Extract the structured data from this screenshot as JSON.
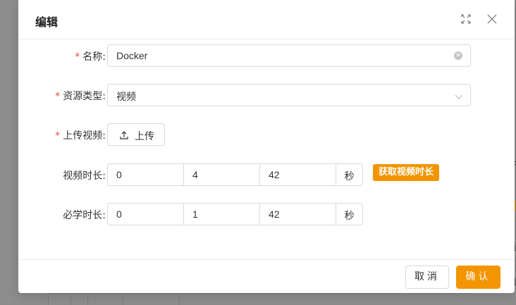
{
  "modal": {
    "title": "编辑"
  },
  "form": {
    "name": {
      "label": "名称:",
      "required": true,
      "value": "Docker"
    },
    "resource_type": {
      "label": "资源类型:",
      "required": true,
      "value": "视频"
    },
    "upload_video": {
      "label": "上传视频:",
      "required": true,
      "button_label": "上传"
    },
    "video_duration": {
      "label": "视频时长:",
      "hours": "0",
      "minutes": "4",
      "seconds": "42",
      "unit": "秒",
      "fetch_button": "获取视频时长"
    },
    "required_duration": {
      "label": "必学时长:",
      "hours": "0",
      "minutes": "1",
      "seconds": "42",
      "unit": "秒"
    }
  },
  "footer": {
    "cancel_label": "取消",
    "ok_label": "确认"
  },
  "colors": {
    "accent": "#f29500",
    "required_mark": "#e74c3c"
  }
}
